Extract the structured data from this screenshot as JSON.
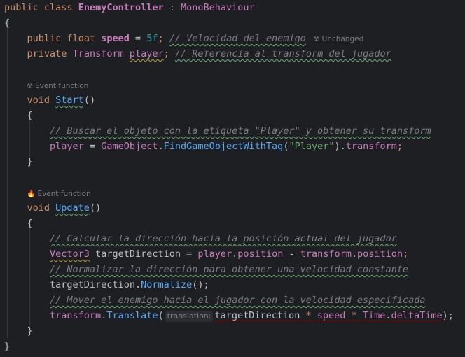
{
  "code": {
    "class_decl": {
      "kw1": "public",
      "kw2": "class",
      "name": "EnemyController",
      "colon": " : ",
      "base": "MonoBehaviour"
    },
    "open_brace": "{",
    "close_brace": "}",
    "speed_line": {
      "kw1": "public",
      "kw2": "float",
      "name": "speed",
      "assign": " = ",
      "value": "5f",
      "semi": ";",
      "comment": "// Velocidad del enemigo",
      "hint": "Unchanged"
    },
    "player_line": {
      "kw": "private",
      "type": "Transform",
      "name": "player",
      "semi": ";",
      "comment": "// Referencia al transform del jugador"
    },
    "start_hint": "Event function",
    "start_decl": {
      "kw": "void",
      "name": "Start",
      "parens": "()"
    },
    "start_body": {
      "comment": "// Buscar el objeto con la etiqueta \"Player\" y obtener su transform",
      "target": "player",
      "assign": " = ",
      "cls": "GameObject",
      "dot1": ".",
      "method": "FindGameObjectWithTag",
      "open": "(",
      "arg": "\"Player\"",
      "close": ").",
      "prop": "transform",
      "semi": ";"
    },
    "update_hint": "Event function",
    "update_decl": {
      "kw": "void",
      "name": "Update",
      "parens": "()"
    },
    "update_body": {
      "comment1": "// Calcular la dirección hacia la posición actual del jugador",
      "vec_type": "Vector3",
      "var": " targetDirection",
      "assign": " = ",
      "p1": "player",
      "dot": ".",
      "pos1": "position",
      "minus": " - ",
      "t1": "transform",
      "pos2": "position",
      "semi": ";",
      "comment2": "// Normalizar la dirección para obtener una velocidad constante",
      "norm_var": "targetDirection",
      "norm_method": "Normalize",
      "norm_end": "();",
      "comment3": "// Mover el enemigo hacia el jugador con la velocidad especificada",
      "tr": "transform",
      "tr_method": "Translate",
      "open": "(",
      "inlay": "translation:",
      "arg1": "targetDirection",
      "star1": " * ",
      "arg2": "speed",
      "star2": " * ",
      "time_cls": "Time",
      "dt": "deltaTime",
      "end": ");"
    }
  }
}
